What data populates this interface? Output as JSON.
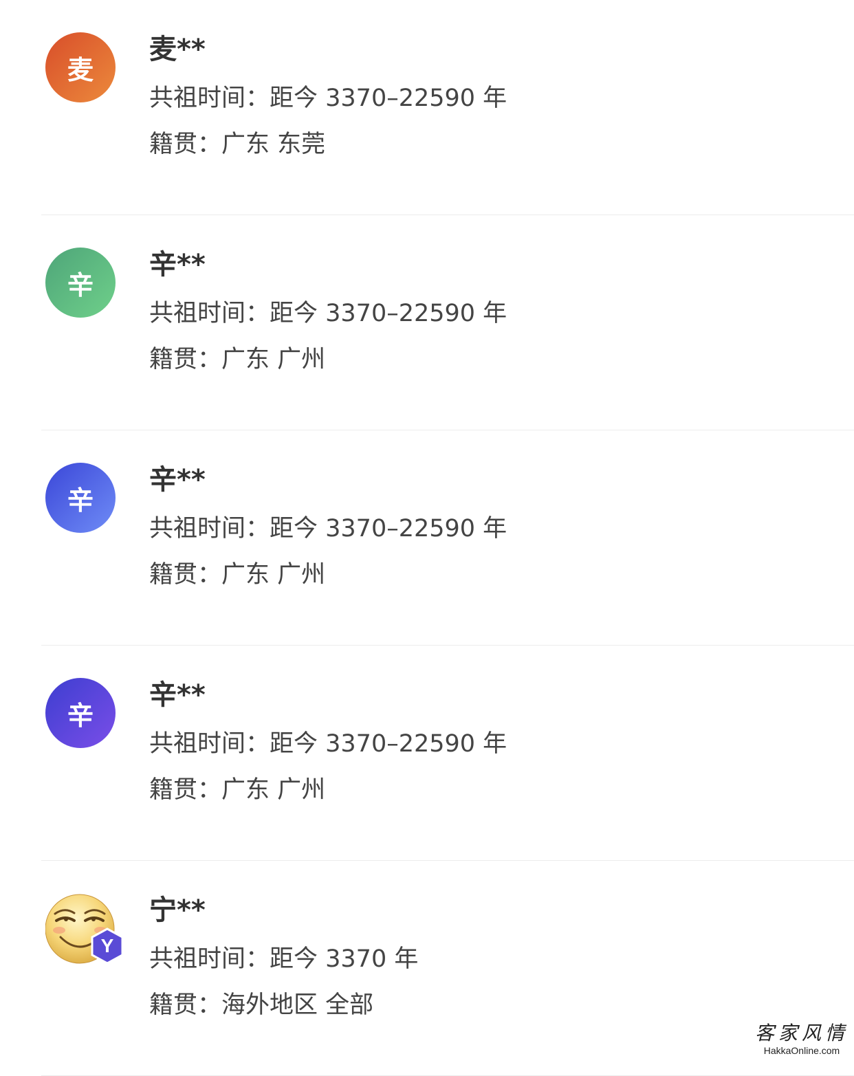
{
  "matches": [
    {
      "avatar_char": "麦",
      "avatar_colors": [
        "#d84e2a",
        "#ec8a3c"
      ],
      "name": "麦**",
      "time_label": "共祖时间：",
      "time_value": "距今 3370–22590 年",
      "origin_label": "籍贯：",
      "origin_value": "广东 东莞"
    },
    {
      "avatar_char": "辛",
      "avatar_colors": [
        "#4ea579",
        "#6fd08a"
      ],
      "name": "辛**",
      "time_label": "共祖时间：",
      "time_value": "距今 3370–22590 年",
      "origin_label": "籍贯：",
      "origin_value": "广东 广州"
    },
    {
      "avatar_char": "辛",
      "avatar_colors": [
        "#3b47d8",
        "#6f8cf6"
      ],
      "name": "辛**",
      "time_label": "共祖时间：",
      "time_value": "距今 3370–22590 年",
      "origin_label": "籍贯：",
      "origin_value": "广东 广州"
    },
    {
      "avatar_char": "辛",
      "avatar_colors": [
        "#3d3ed0",
        "#7a4ee8"
      ],
      "name": "辛**",
      "time_label": "共祖时间：",
      "time_value": "距今 3370–22590 年",
      "origin_label": "籍贯：",
      "origin_value": "广东 广州"
    },
    {
      "avatar_icon": "smiling-emoji-avatar-icon",
      "badge_letter": "Y",
      "badge_color": "#5a4bd6",
      "name": "宁**",
      "time_label": "共祖时间：",
      "time_value": "距今 3370 年",
      "origin_label": "籍贯：",
      "origin_value": "海外地区 全部"
    }
  ],
  "watermark": {
    "title": "客家风情",
    "site": "HakkaOnline.com"
  }
}
